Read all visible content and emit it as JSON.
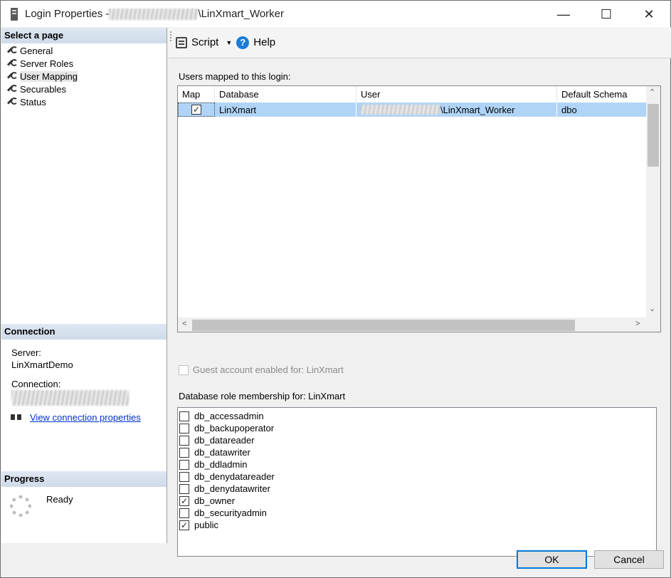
{
  "window": {
    "title_prefix": "Login Properties - ",
    "title_suffix": "\\LinXmart_Worker",
    "minimize": "—",
    "maximize": "☐",
    "close": "✕"
  },
  "left_panel": {
    "header": "Select a page",
    "pages": [
      {
        "label": "General"
      },
      {
        "label": "Server Roles"
      },
      {
        "label": "User Mapping",
        "selected": true
      },
      {
        "label": "Securables"
      },
      {
        "label": "Status"
      }
    ]
  },
  "connection": {
    "header": "Connection",
    "server_label": "Server:",
    "server_value": "LinXmartDemo",
    "connection_label": "Connection:",
    "link_text": "View connection properties"
  },
  "progress": {
    "header": "Progress",
    "status": "Ready"
  },
  "toolbar": {
    "script_label": "Script",
    "help_label": "Help"
  },
  "users_mapped": {
    "label": "Users mapped to this login:",
    "columns": [
      "Map",
      "Database",
      "User",
      "Default Schema"
    ],
    "rows": [
      {
        "map": true,
        "database": "LinXmart",
        "user_suffix": "\\LinXmart_Worker",
        "schema": "dbo"
      }
    ]
  },
  "guest": {
    "label": "Guest account enabled for: LinXmart",
    "checked": false
  },
  "roles": {
    "label": "Database role membership for: LinXmart",
    "items": [
      {
        "label": "db_accessadmin",
        "checked": false
      },
      {
        "label": "db_backupoperator",
        "checked": false
      },
      {
        "label": "db_datareader",
        "checked": false
      },
      {
        "label": "db_datawriter",
        "checked": false
      },
      {
        "label": "db_ddladmin",
        "checked": false
      },
      {
        "label": "db_denydatareader",
        "checked": false
      },
      {
        "label": "db_denydatawriter",
        "checked": false
      },
      {
        "label": "db_owner",
        "checked": true
      },
      {
        "label": "db_securityadmin",
        "checked": false
      },
      {
        "label": "public",
        "checked": true
      }
    ]
  },
  "buttons": {
    "ok": "OK",
    "cancel": "Cancel"
  },
  "colors": {
    "selected_row": "#b0d4f7",
    "section_header": "#cfdbea",
    "link": "#0033cc",
    "ok_border": "#0078d7"
  }
}
